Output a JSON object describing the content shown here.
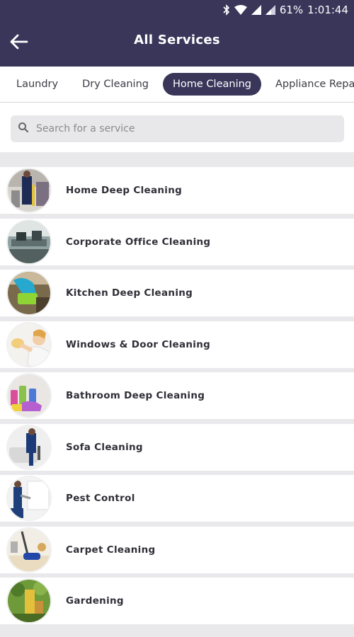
{
  "status": {
    "battery": "61%",
    "time": "1:01:44"
  },
  "header": {
    "title": "All Services"
  },
  "tabs": [
    {
      "label": "Laundry"
    },
    {
      "label": "Dry Cleaning"
    },
    {
      "label": "Home Cleaning",
      "active": true
    },
    {
      "label": "Appliance Repa"
    }
  ],
  "search": {
    "placeholder": "Search for a service",
    "value": ""
  },
  "services": [
    {
      "label": "Home Deep Cleaning",
      "icon": "cleaning-trolley-image"
    },
    {
      "label": "Corporate Office Cleaning",
      "icon": "office-image"
    },
    {
      "label": "Kitchen Deep Cleaning",
      "icon": "glove-sponge-image"
    },
    {
      "label": "Windows & Door Cleaning",
      "icon": "window-wiping-image"
    },
    {
      "label": "Bathroom Deep Cleaning",
      "icon": "cleaning-supplies-image"
    },
    {
      "label": "Sofa Cleaning",
      "icon": "sofa-image"
    },
    {
      "label": "Pest Control",
      "icon": "pest-spray-image"
    },
    {
      "label": "Carpet Cleaning",
      "icon": "vacuum-image"
    },
    {
      "label": "Gardening",
      "icon": "garden-image"
    }
  ],
  "colors": {
    "primary": "#3a365a",
    "background": "#e9e9ec"
  }
}
